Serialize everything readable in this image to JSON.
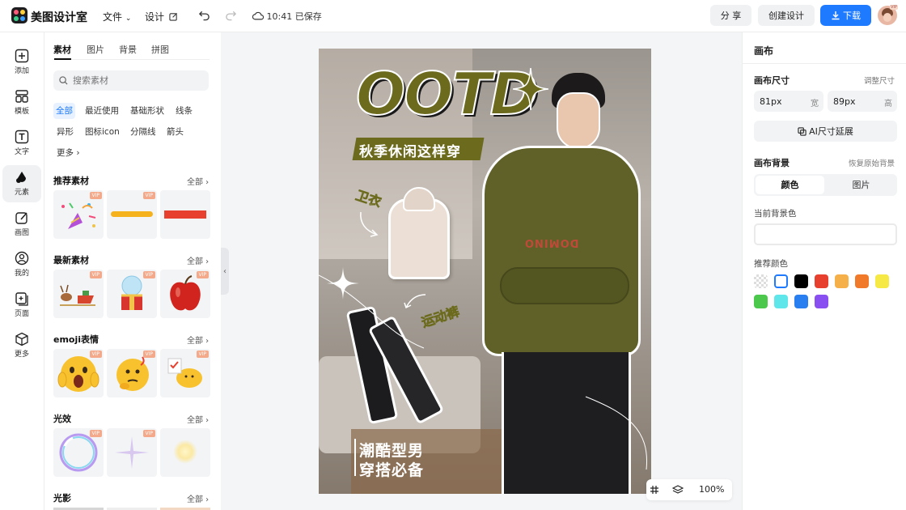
{
  "app": {
    "name": "美图设计室"
  },
  "topbar": {
    "file_menu": "文件",
    "design_menu": "设计",
    "save_status": "10:41 已保存",
    "share": "分 享",
    "create": "创建设计",
    "download": "下载",
    "avatar_badge": "VIP"
  },
  "leftnav": [
    {
      "label": "添加",
      "icon": "plus-square-icon"
    },
    {
      "label": "模板",
      "icon": "template-icon"
    },
    {
      "label": "文字",
      "icon": "text-icon"
    },
    {
      "label": "元素",
      "icon": "shapes-icon"
    },
    {
      "label": "画图",
      "icon": "draw-icon"
    },
    {
      "label": "我的",
      "icon": "user-icon"
    },
    {
      "label": "页面",
      "icon": "page-add-icon"
    },
    {
      "label": "更多",
      "icon": "cube-icon"
    }
  ],
  "panel": {
    "tabs": [
      "素材",
      "图片",
      "背景",
      "拼图"
    ],
    "search_placeholder": "搜索素材",
    "chips": [
      "全部",
      "最近使用",
      "基础形状",
      "线条",
      "异形",
      "图标icon",
      "分隔线",
      "箭头",
      "更多"
    ],
    "more_chip_arrow": "›",
    "vip": "VIP",
    "all_label": "全部",
    "sections": [
      {
        "title": "推荐素材",
        "tiles": [
          "party-popper",
          "yellow-brush-stroke",
          "red-bar"
        ]
      },
      {
        "title": "最新素材",
        "tiles": [
          "reindeer-sleigh",
          "snow-globe-gift",
          "red-apple"
        ]
      },
      {
        "title": "emoji表情",
        "tiles": [
          "shocked-emoji",
          "thinking-emoji",
          "chick-emoji"
        ]
      },
      {
        "title": "光效",
        "tiles": [
          "bubble-ring",
          "sparkle",
          "glow"
        ]
      },
      {
        "title": "光影",
        "tiles": []
      }
    ]
  },
  "canvas": {
    "headline": "OOTD",
    "banner": "秋季休闲这样穿",
    "label_hoodie": "卫衣",
    "label_pants": "运动裤",
    "caption_line1": "潮酷型男",
    "caption_line2": "穿搭必备",
    "hoodie_print": "DOMINO"
  },
  "zoom": {
    "value": "100%"
  },
  "right": {
    "title": "画布",
    "size_label": "画布尺寸",
    "resize_link": "调整尺寸",
    "width_value": "81px",
    "width_unit": "宽",
    "height_value": "89px",
    "height_unit": "高",
    "ai_extend": "AI尺寸延展",
    "bg_label": "画布背景",
    "bg_reset": "恢复原始背景",
    "tab_color": "颜色",
    "tab_image": "图片",
    "current_bg_label": "当前背景色",
    "recommended_label": "推荐颜色",
    "colors": [
      "transparent",
      "#ffffff",
      "#000000",
      "#e8402e",
      "#f6b04a",
      "#f07a2a",
      "#f6e945",
      "#4cc94c",
      "#5ee6ea",
      "#2a7ff0",
      "#8a4ff0"
    ]
  }
}
